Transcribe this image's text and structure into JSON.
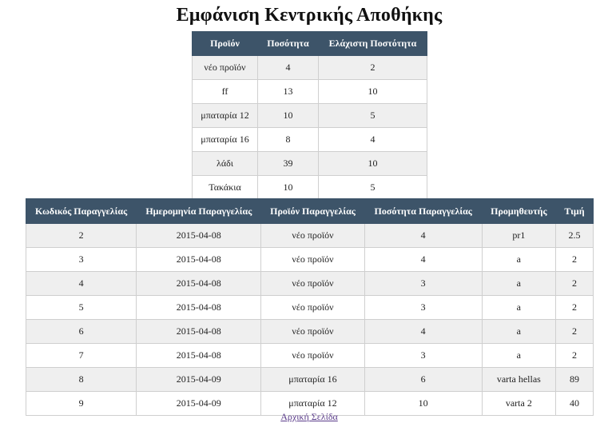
{
  "page": {
    "title": "Εμφάνιση Κεντρικής Αποθήκης",
    "home_link": "Αρχική Σελίδα"
  },
  "stock_table": {
    "headers": [
      "Προϊόν",
      "Ποσότητα",
      "Ελάχιστη Ποστότητα"
    ],
    "rows": [
      [
        "νέο προϊόν",
        "4",
        "2"
      ],
      [
        "ff",
        "13",
        "10"
      ],
      [
        "μπαταρία 12",
        "10",
        "5"
      ],
      [
        "μπαταρία 16",
        "8",
        "4"
      ],
      [
        "λάδι",
        "39",
        "10"
      ],
      [
        "Τακάκια",
        "10",
        "5"
      ]
    ]
  },
  "orders_table": {
    "headers": [
      "Κωδικός Παραγγελίας",
      "Ημερομηνία Παραγγελίας",
      "Προϊόν Παραγγελίας",
      "Ποσότητα Παραγγελίας",
      "Προμηθευτής",
      "Τιμή"
    ],
    "rows": [
      [
        "2",
        "2015-04-08",
        "νέο προϊόν",
        "4",
        "pr1",
        "2.5"
      ],
      [
        "3",
        "2015-04-08",
        "νέο προϊόν",
        "4",
        "a",
        "2"
      ],
      [
        "4",
        "2015-04-08",
        "νέο προϊόν",
        "3",
        "a",
        "2"
      ],
      [
        "5",
        "2015-04-08",
        "νέο προϊόν",
        "3",
        "a",
        "2"
      ],
      [
        "6",
        "2015-04-08",
        "νέο προϊόν",
        "4",
        "a",
        "2"
      ],
      [
        "7",
        "2015-04-08",
        "νέο προϊόν",
        "3",
        "a",
        "2"
      ],
      [
        "8",
        "2015-04-09",
        "μπαταρία 16",
        "6",
        "varta hellas",
        "89"
      ],
      [
        "9",
        "2015-04-09",
        "μπαταρία 12",
        "10",
        "varta 2",
        "40"
      ]
    ]
  },
  "colors": {
    "header_bg": "#3d5469",
    "header_text": "#ffffff",
    "row_alt_bg": "#efefef",
    "link": "#5a3b8a"
  }
}
